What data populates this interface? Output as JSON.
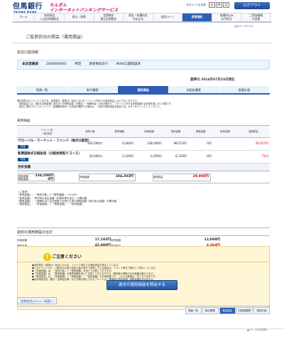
{
  "header": {
    "logo_kanji": "但馬銀行",
    "logo_roman": "TAJIMA BANK",
    "service_line1": "たんぎん",
    "service_line2": "インターネットバンキングサービス",
    "font_size_label": "文字サイズを変更",
    "font_small": "小",
    "font_medium": "中",
    "font_large": "大",
    "logout": "ログアウト"
  },
  "nav": [
    {
      "label": "ホーム"
    },
    {
      "label": "残高照会\n入出金明細照会"
    },
    {
      "label": "振込・振替"
    },
    {
      "label": "定期預金\n積立定期預金"
    },
    {
      "label": "税金・各種料金\nの払込み"
    },
    {
      "label": "信託ローン"
    },
    {
      "label": "投資信託",
      "active": true
    },
    {
      "label": "各種申込み\nお手続き"
    },
    {
      "label": "ご登録情報\nの変更"
    }
  ],
  "screen_id": "画面ID：BPR106",
  "page_title": "ご投資状況の照会（運用損益）",
  "account_section_title": "投信口座情報",
  "account": {
    "branch": "本店営業部",
    "number": "2000000001",
    "type": "特定",
    "holder": "源泉徴収あり",
    "nisa": "NISA口座開設済"
  },
  "base_date": "基準日 2014年07月23日現在",
  "tabs": [
    {
      "label": "残高一覧"
    },
    {
      "label": "取引履歴"
    },
    {
      "label": "運用損益",
      "active": true
    },
    {
      "label": "分配金履歴"
    },
    {
      "label": "投資計画"
    }
  ],
  "notes": [
    "現在保有中のファンドに対する、前営業日（基準日）時点における「ファンド単位での運用損益」は以下のとおりです。",
    "・運用損益とは、現在の評価金額と過去までの受取金額（分配金・一部解約金）の合計額から、ファンドに対する投資金額の合計額を差し引いた額です。",
    "・過去に保有されていたファンド（全額解約済み）の損益を確認する場合は、「過去の運用損益を照会する」ボタンをクリックしてください。"
  ],
  "holdings_title": "運用損益",
  "headers": {
    "fund": "ファンド名",
    "fund_sub": "一般/特定",
    "units": "保有口数",
    "nav": "基準価額",
    "valuation": "評価金額",
    "invested": "投資金額",
    "received": "受取金額",
    "invested_sub": "投資金額",
    "pl": "運用損益"
  },
  "rows": [
    {
      "fund": "グローバル・マーケット・ファンド（毎月分配型）",
      "kind": "特定",
      "units": "320,000口",
      "nav": "4,000円",
      "valuation": "128,000円",
      "invested": "98,073円",
      "received": "0円",
      "pl": "29,927円"
    },
    {
      "fund": "新興国株式日経投信（分配金受取りコース）",
      "kind": "特定",
      "units": "20,000口",
      "nav": "3,100円",
      "valuation": "6,200円",
      "invested": "6,129円",
      "received": "0円",
      "pl": "71円"
    }
  ],
  "total": {
    "title": "合計金額",
    "invested_label": "評価金額\n受取金額",
    "invested_value": "134,200円\n0円",
    "valuation_label": "評価金額",
    "valuation_value": "104,203円",
    "pl_label": "運用損益",
    "pl_value": "29,998円"
  },
  "formula": [
    "（ご参考）",
    "「評価金額」：「保有口数」×「基準価額」÷10,000",
    "「投資金額」：買付時の支払金額（手数料等を含む）の累計額",
    "「受取金額」：一部解約またはお受取りを受けた際の受取金額（税引後の金額）の累計額",
    "「運用損益」：「評価金額」＋「受取金額」－「投資金額」"
  ],
  "past": {
    "title": "過去の運用損益の合計",
    "valuation_label": "評価金額",
    "valuation_value": "17,182円",
    "invested_label": "投資金額",
    "invested_value": "12,000円",
    "received_label": "受取金額",
    "received_value": "42,000円",
    "pl_label": "運用損益",
    "pl_value": "4,364円"
  },
  "notice": {
    "title": "ご注意ください",
    "lines": [
      "●前営業日（基準日）時点における、ファンド単位での運用損益を表示しています。",
      "●1つのファンドを、一般NISA口座と特定口座の両方で保有している場合は、ファンド単位で集計して表示しています。",
      "●「評価金額」は、「保有口数」と「基準価額」を用いて計算しております。",
      "●「評価金額」は、「基準価額」の基準価額を用いて計算しておりますので、解約時の実際の合計金額は異なります。",
      "●「運用損益」は、「評価金額」＋「受取金額」－「投資金額」の計算結果です。これらの数値は、あくまで目安です。",
      "●他の販売会社（銀行・証券会社等）からお預け替えされたファンドは、移管前の投資金額・受取金額を含みません。"
    ]
  },
  "past_button": "過去の運用損益を照会する",
  "back_link": "投資信託メニュー画面へ",
  "footer_tabs": [
    {
      "label": "残高一覧"
    },
    {
      "label": "取引履歴"
    },
    {
      "label": "運用損益",
      "active": true
    },
    {
      "label": "分配金履歴"
    },
    {
      "label": "投資計画"
    }
  ],
  "page_top": "▲ページの先頭へ"
}
